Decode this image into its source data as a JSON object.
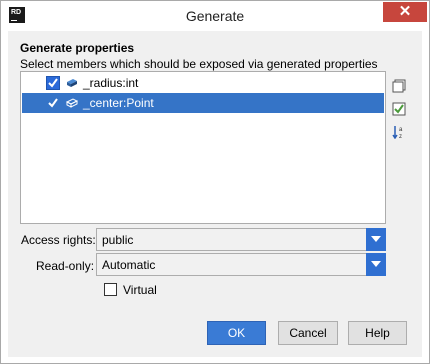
{
  "window": {
    "title": "Generate",
    "app_icon_text": "RD"
  },
  "panel": {
    "title": "Generate properties",
    "subtitle": "Select members which should be exposed via generated properties"
  },
  "members": [
    {
      "label": "_radius:int",
      "checked": true,
      "selected": false,
      "icon": "field-icon"
    },
    {
      "label": "_center:Point",
      "checked": true,
      "selected": true,
      "icon": "field-icon"
    }
  ],
  "side_tools": [
    "select-none-icon",
    "select-all-icon",
    "sort-icon"
  ],
  "access_rights": {
    "label": "Access rights:",
    "value": "public"
  },
  "read_only": {
    "label": "Read-only:",
    "value": "Automatic"
  },
  "virtual": {
    "label": "Virtual",
    "checked": false
  },
  "buttons": {
    "ok": "OK",
    "cancel": "Cancel",
    "help": "Help"
  },
  "colors": {
    "selection": "#3574c7",
    "primary_button": "#3a7bd5",
    "close_button": "#c7463d"
  }
}
